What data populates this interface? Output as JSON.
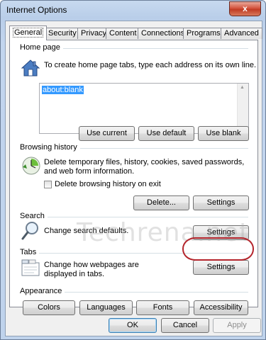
{
  "window": {
    "title": "Internet Options",
    "close_glyph": "x"
  },
  "tabs": [
    {
      "label": "General",
      "active": true
    },
    {
      "label": "Security"
    },
    {
      "label": "Privacy"
    },
    {
      "label": "Content"
    },
    {
      "label": "Connections"
    },
    {
      "label": "Programs"
    },
    {
      "label": "Advanced"
    }
  ],
  "home_page": {
    "label": "Home page",
    "description": "To create home page tabs, type each address on its own line.",
    "url": "about:blank",
    "buttons": {
      "use_current": "Use current",
      "use_default": "Use default",
      "use_blank": "Use blank"
    },
    "icon": "house-icon"
  },
  "browsing_history": {
    "label": "Browsing history",
    "description": "Delete temporary files, history, cookies, saved passwords, and web form information.",
    "checkbox_label": "Delete browsing history on exit",
    "checkbox_checked": false,
    "buttons": {
      "delete": "Delete...",
      "settings": "Settings"
    },
    "icon": "history-icon"
  },
  "search": {
    "label": "Search",
    "description": "Change search defaults.",
    "buttons": {
      "settings": "Settings"
    },
    "icon": "magnifier-icon"
  },
  "tabs_section": {
    "label": "Tabs",
    "description": "Change how webpages are displayed in tabs.",
    "buttons": {
      "settings": "Settings"
    },
    "icon": "tabs-icon"
  },
  "appearance": {
    "label": "Appearance",
    "buttons": {
      "colors": "Colors",
      "languages": "Languages",
      "fonts": "Fonts",
      "accessibility": "Accessibility"
    }
  },
  "footer": {
    "ok": "OK",
    "cancel": "Cancel",
    "apply": "Apply"
  },
  "watermark": "Techrena.net",
  "colors": {
    "highlight_ring": "#b4252c",
    "selection": "#3399ff"
  }
}
